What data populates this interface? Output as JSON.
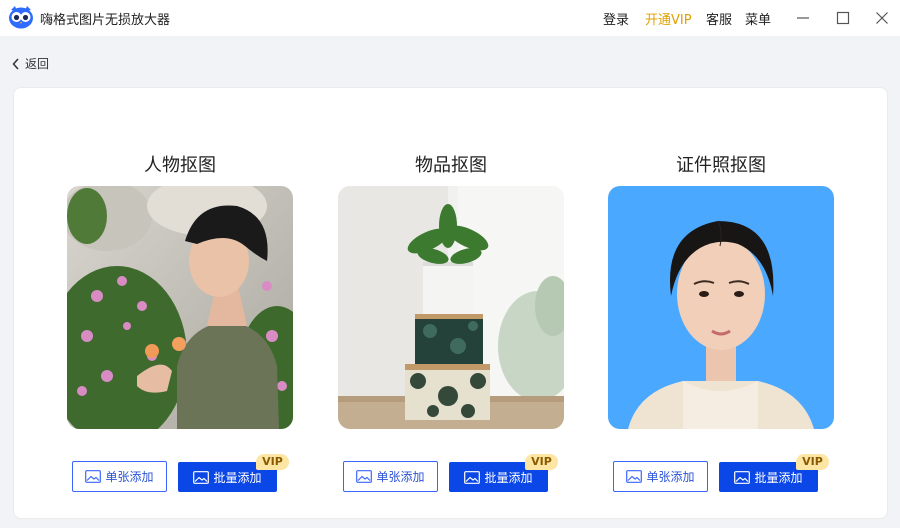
{
  "app": {
    "title": "嗨格式图片无损放大器"
  },
  "nav": {
    "login": "登录",
    "vip": "开通VIP",
    "service": "客服",
    "menu": "菜单"
  },
  "back": {
    "label": "返回"
  },
  "cards": [
    {
      "title": "人物抠图",
      "single_label": "单张添加",
      "batch_label": "批量添加",
      "vip_badge": "VIP"
    },
    {
      "title": "物品抠图",
      "single_label": "单张添加",
      "batch_label": "批量添加",
      "vip_badge": "VIP"
    },
    {
      "title": "证件照抠图",
      "single_label": "单张添加",
      "batch_label": "批量添加",
      "vip_badge": "VIP"
    }
  ],
  "colors": {
    "accent": "#0b47e6",
    "vip": "#e0a000",
    "id_photo_bg": "#4aa8ff"
  }
}
